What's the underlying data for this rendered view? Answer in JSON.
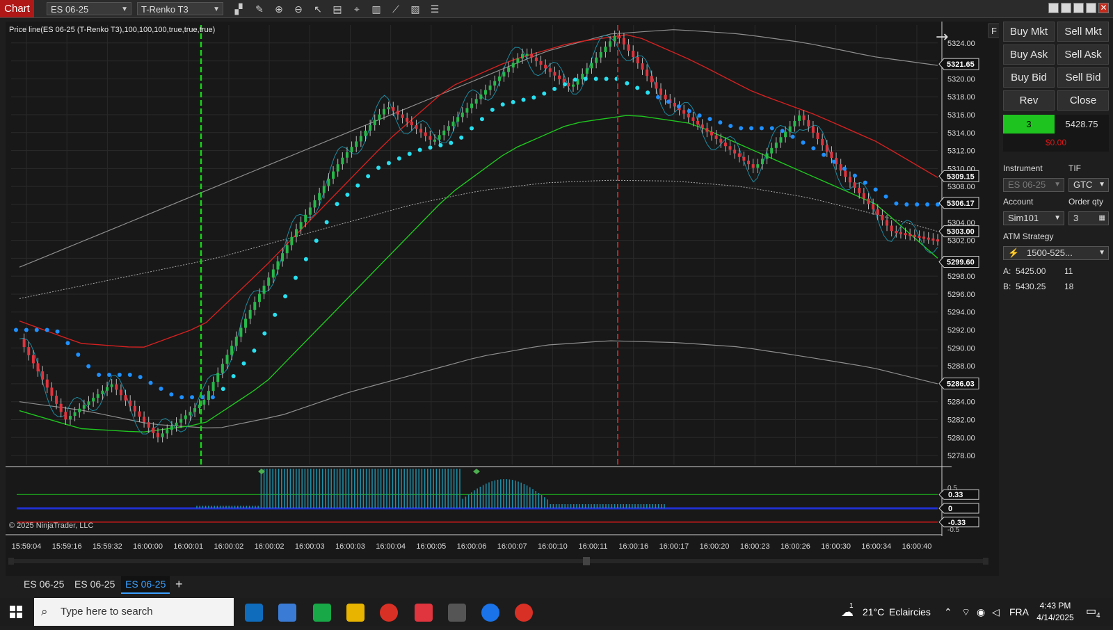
{
  "toolbar": {
    "chart_label": "Chart",
    "instrument": "ES 06-25",
    "bar_type": "T-Renko T3"
  },
  "chart": {
    "indicator_label": "Price line(ES 06-25 (T-Renko T3),100,100,100,true,true,true)",
    "copyright": "© 2025 NinjaTrader, LLC",
    "f_button": "F",
    "price_ticks": [
      "5324.00",
      "5322.00",
      "5320.00",
      "5318.00",
      "5316.00",
      "5314.00",
      "5312.00",
      "5310.00",
      "5308.00",
      "5306.00",
      "5304.00",
      "5302.00",
      "5300.00",
      "5298.00",
      "5296.00",
      "5294.00",
      "5292.00",
      "5290.00",
      "5288.00",
      "5286.00",
      "5284.00",
      "5282.00",
      "5280.00",
      "5278.00"
    ],
    "price_markers": [
      {
        "label": "5321.65",
        "price": 5321.65
      },
      {
        "label": "5309.15",
        "price": 5309.15
      },
      {
        "label": "5306.17",
        "price": 5306.17
      },
      {
        "label": "5303.00",
        "price": 5303.0
      },
      {
        "label": "5299.60",
        "price": 5299.6
      },
      {
        "label": "5286.03",
        "price": 5286.03
      }
    ],
    "osc_ticks": [
      "0.5",
      "-0.5"
    ],
    "osc_markers": [
      "0.33",
      "0",
      "-0.33"
    ],
    "time_labels": [
      "15:59:04",
      "15:59:16",
      "15:59:32",
      "16:00:00",
      "16:00:01",
      "16:00:02",
      "16:00:02",
      "16:00:03",
      "16:00:03",
      "16:00:04",
      "16:00:05",
      "16:00:06",
      "16:00:07",
      "16:00:10",
      "16:00:11",
      "16:00:16",
      "16:00:17",
      "16:00:20",
      "16:00:23",
      "16:00:26",
      "16:00:30",
      "16:00:34",
      "16:00:40"
    ],
    "colors": {
      "up": "#27b84a",
      "down": "#e0343e",
      "bullish_dots": "#28e0f0",
      "bearish_dots": "#1e90ff",
      "upper_band": "#d42020",
      "lower_band": "#1fc61f",
      "gray_band": "#8f8f8f",
      "vline_green": "#18d418",
      "vline_red": "#e01818"
    }
  },
  "chart_data": {
    "type": "candlestick",
    "y_axis_range": [
      5277,
      5326
    ],
    "oscillator_range": [
      -0.55,
      0.55
    ],
    "vertical_lines": [
      {
        "label": "16:00:01",
        "color": "green"
      },
      {
        "label": "16:00:16",
        "color": "red"
      }
    ]
  },
  "order_panel": {
    "buy_mkt": "Buy Mkt",
    "sell_mkt": "Sell Mkt",
    "buy_ask": "Buy Ask",
    "sell_ask": "Sell Ask",
    "buy_bid": "Buy Bid",
    "sell_bid": "Sell Bid",
    "rev": "Rev",
    "close": "Close",
    "position_qty": "3",
    "position_price": "5428.75",
    "pnl": "$0.00",
    "instrument_label": "Instrument",
    "instrument_value": "ES 06-25",
    "tif_label": "TIF",
    "tif_value": "GTC",
    "account_label": "Account",
    "account_value": "Sim101",
    "order_qty_label": "Order qty",
    "order_qty_value": "3",
    "atm_label": "ATM Strategy",
    "atm_value": "1500-525...",
    "ask_label": "A:",
    "ask_price": "5425.00",
    "ask_size": "11",
    "bid_label": "B:",
    "bid_price": "5430.25",
    "bid_size": "18"
  },
  "tabs": [
    "ES 06-25",
    "ES 06-25",
    "ES 06-25"
  ],
  "add_tab": "+",
  "taskbar": {
    "search_placeholder": "Type here to search",
    "weather_temp": "21°C",
    "weather_desc": "Eclaircies",
    "weather_badge": "1",
    "language": "FRA",
    "time": "4:43 PM",
    "date": "4/14/2025",
    "notif_count": "4"
  }
}
